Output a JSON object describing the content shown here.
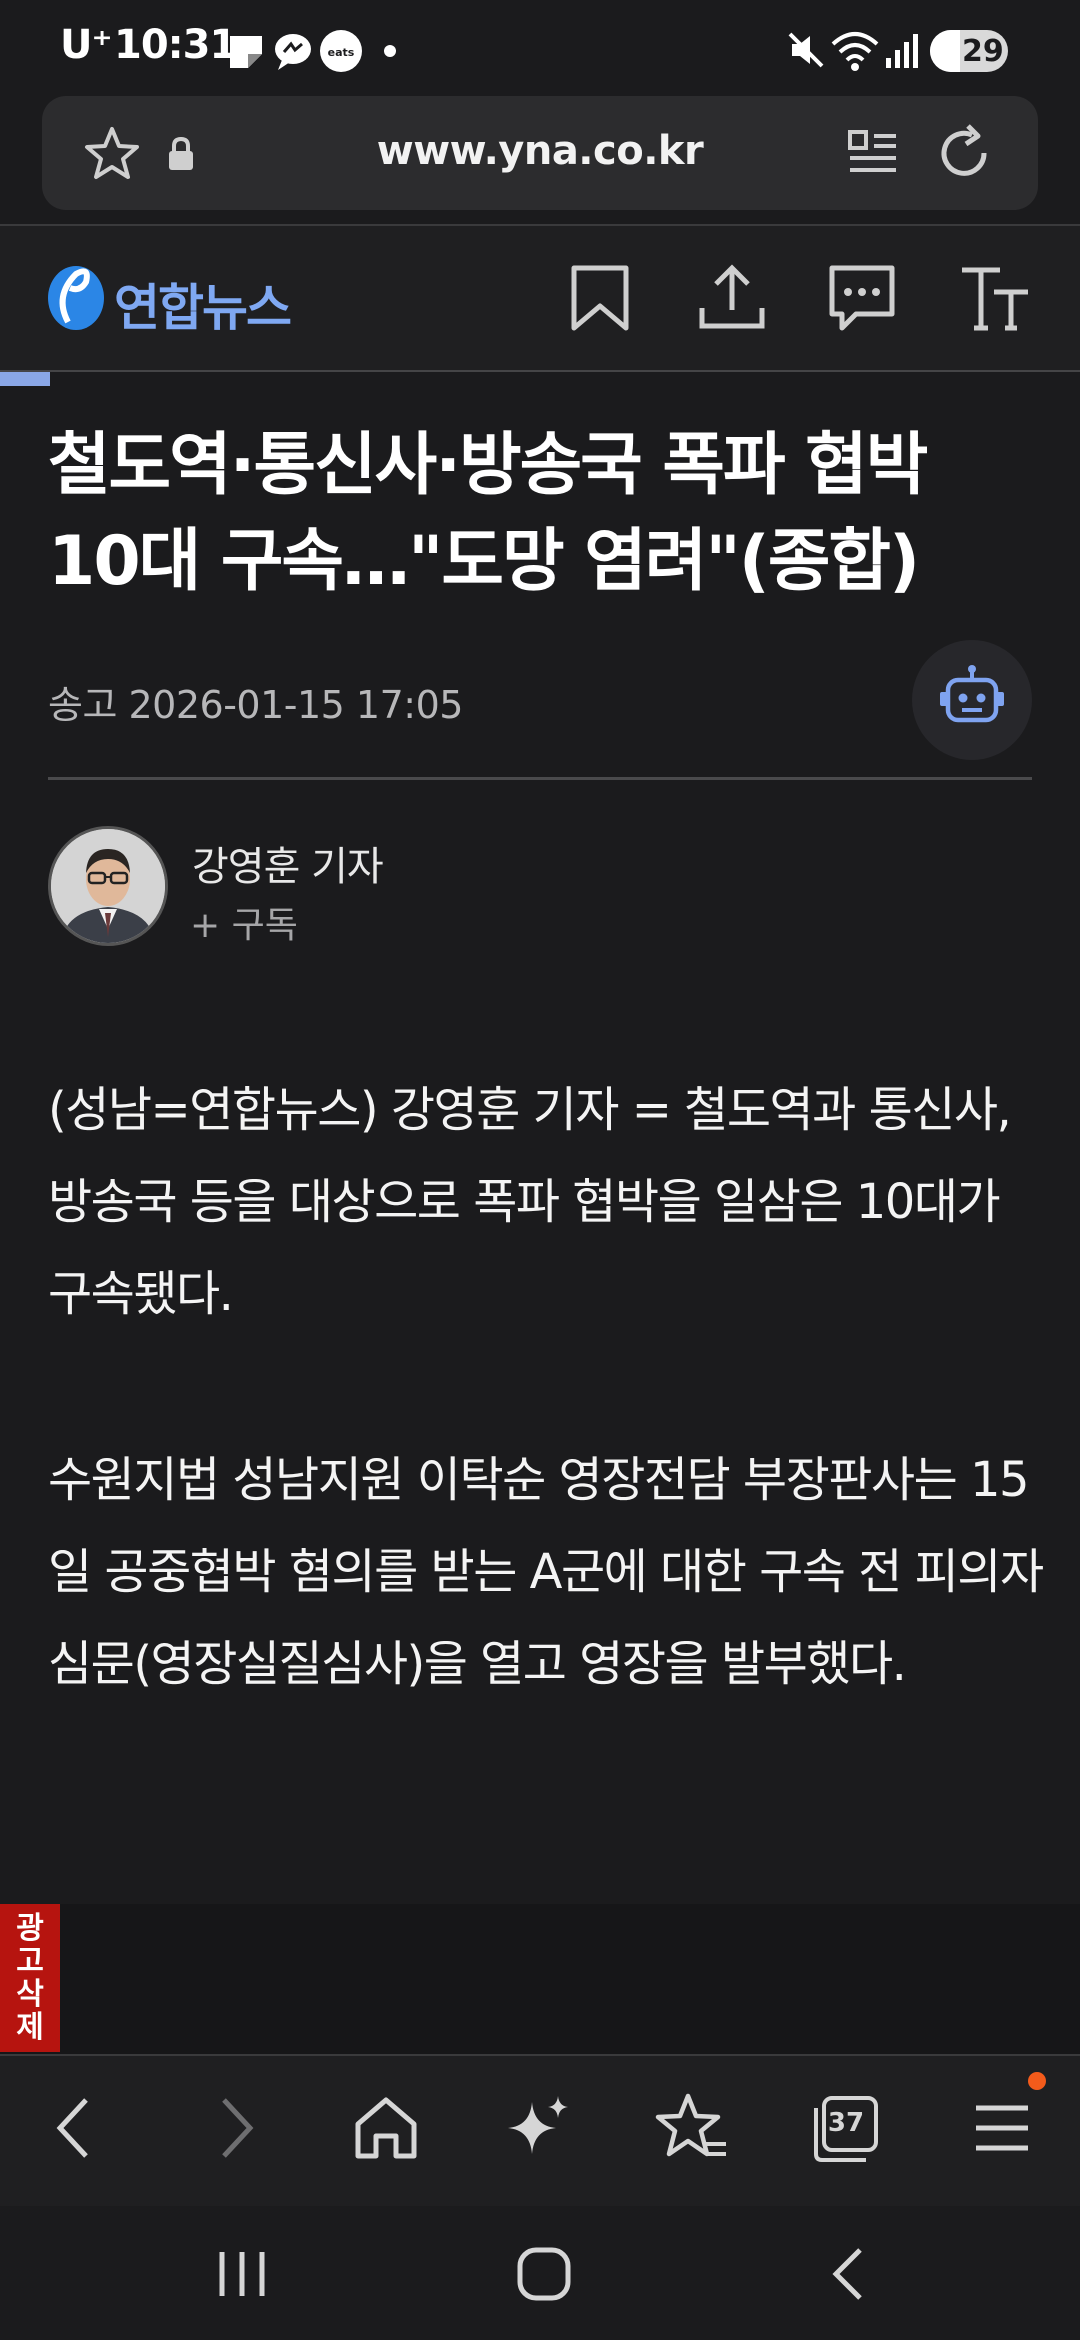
{
  "status_bar": {
    "carrier": "U⁺",
    "time": "10:31",
    "app_badge": "eats",
    "battery": "29"
  },
  "browser": {
    "url": "www.yna.co.kr",
    "tabs_count": "37"
  },
  "site": {
    "logo_text": "연합뉴스"
  },
  "article": {
    "headline": "철도역·통신사·방송국 폭파 협박 10대 구속…\"도망 염려\"(종합)",
    "date": "송고 2026-01-15 17:05",
    "reporter_name": "강영훈 기자",
    "subscribe_label": "+ 구독",
    "paragraphs": [
      "(성남=연합뉴스) 강영훈 기자 = 철도역과 통신사, 방송국 등을 대상으로 폭파 협박을 일삼은 10대가 구속됐다.",
      "수원지법 성남지원 이탁순 영장전담 부장판사는 15일 공중협박 혐의를 받는 A군에 대한 구속 전 피의자 심문(영장실질심사)을 열고 영장을 발부했다."
    ]
  },
  "ad": {
    "remove_label": "광고삭제"
  },
  "colors": {
    "background": "#1b1b1d",
    "logo_blue": "#2b86e6",
    "accent_icon": "#7fa3f0",
    "ad_red": "#b6140f",
    "notification_dot": "#f35b1b"
  },
  "icons": {
    "header": [
      "bookmark-icon",
      "share-icon",
      "comment-icon",
      "font-size-icon"
    ],
    "toolbar": [
      "back-icon",
      "forward-icon",
      "home-icon",
      "sparkle-icon",
      "favorites-icon",
      "tabs-icon",
      "menu-icon"
    ],
    "nav": [
      "recent-apps-icon",
      "home-nav-icon",
      "back-nav-icon"
    ]
  }
}
